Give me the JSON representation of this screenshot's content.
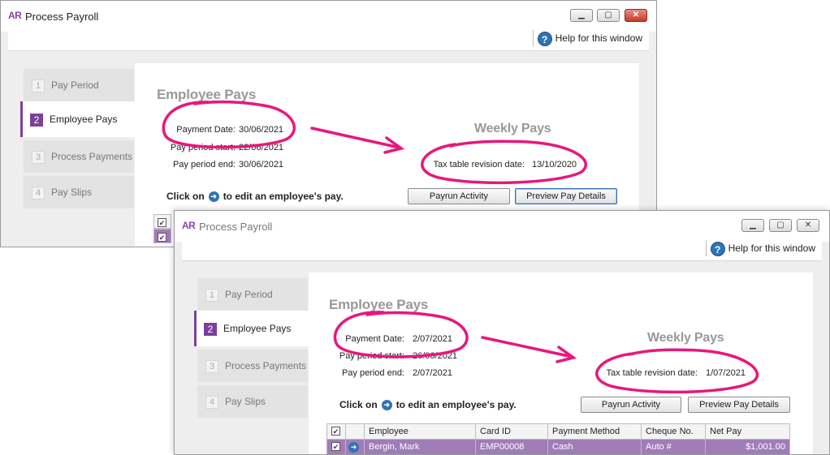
{
  "app": {
    "logo": "AR",
    "title": "Process Payroll",
    "help_label": "Help for this window"
  },
  "nav": [
    {
      "num": "1",
      "label": "Pay Period"
    },
    {
      "num": "2",
      "label": "Employee Pays"
    },
    {
      "num": "3",
      "label": "Process Payments"
    },
    {
      "num": "4",
      "label": "Pay Slips"
    }
  ],
  "labels": {
    "heading": "Employee Pays",
    "pay_type": "Weekly Pays",
    "payment_date": "Payment Date:",
    "pay_period_start": "Pay period start:",
    "pay_period_end": "Pay period end:",
    "tax_table": "Tax table revision date:",
    "click_on": "Click on",
    "click_on_suffix": "to edit an employee's pay.",
    "payrun_activity": "Payrun Activity",
    "preview_pay_details": "Preview Pay Details"
  },
  "before": {
    "payment_date": "30/06/2021",
    "pay_period_start": "22/06/2021",
    "pay_period_end": "30/06/2021",
    "tax_table_date": "13/10/2020"
  },
  "after": {
    "payment_date": "2/07/2021",
    "pay_period_start": "26/06/2021",
    "pay_period_end": "2/07/2021",
    "tax_table_date": "1/07/2021"
  },
  "grid": {
    "columns": [
      "Employee",
      "Card ID",
      "Payment Method",
      "Cheque No.",
      "Net Pay"
    ],
    "rows": [
      {
        "employee": "Bergin, Mark",
        "card_id": "EMP00008",
        "method": "Cash",
        "cheque": "Auto #",
        "net_pay": "$1,001.00"
      }
    ]
  },
  "colors": {
    "accent": "#7d3f98",
    "annotation": "#e8177d",
    "help_blue": "#2f73b7"
  }
}
